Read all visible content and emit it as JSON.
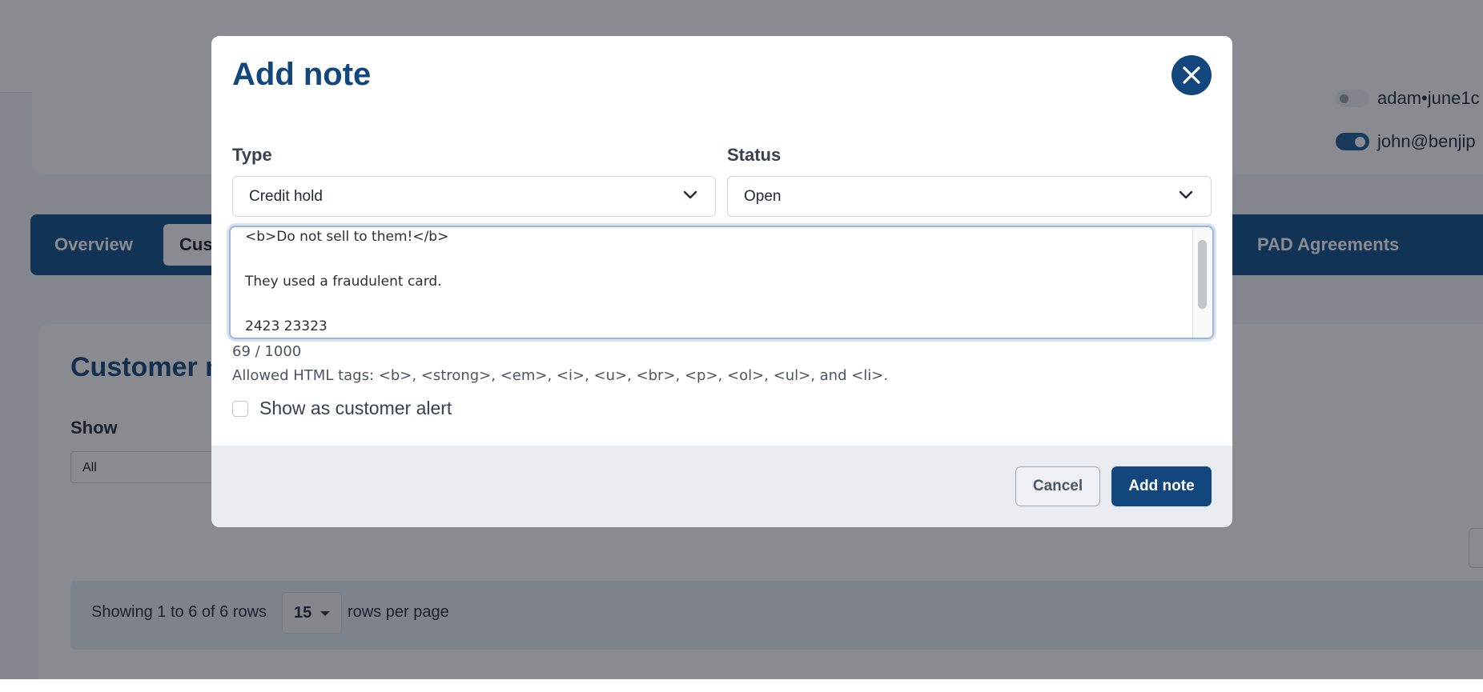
{
  "background": {
    "users": [
      {
        "label": "adam•june1c",
        "enabled": false
      },
      {
        "label": "john@benjip",
        "enabled": true
      }
    ],
    "tabs": [
      {
        "label": "Overview"
      },
      {
        "label": "Cus",
        "active": true
      },
      {
        "label": "PAD Agreements"
      }
    ],
    "section_title": "Customer n",
    "show_label": "Show",
    "show_value": "All",
    "pagination": {
      "showing_text": "Showing 1 to 6 of 6 rows",
      "rows_per_page_value": "15",
      "rows_per_page_suffix": "rows per page"
    }
  },
  "modal": {
    "title": "Add note",
    "close_icon": "close-icon",
    "type": {
      "label": "Type",
      "value": "Credit hold"
    },
    "status": {
      "label": "Status",
      "value": "Open"
    },
    "note_text": "<b>Do not sell to them!</b>\n\nThey used a fraudulent card.\n\n2423 23323",
    "char_count": "69 / 1000",
    "allowed_tags_text": "Allowed HTML tags: <b>, <strong>, <em>, <i>, <u>, <br>, <p>, <ol>, <ul>, and <li>.",
    "customer_alert_label": "Show as customer alert",
    "customer_alert_checked": false,
    "cancel_label": "Cancel",
    "submit_label": "Add note"
  },
  "colors": {
    "brand": "#12477e",
    "tab_bar": "#0f4f8a",
    "overlay": "rgba(20,24,33,0.5)"
  }
}
